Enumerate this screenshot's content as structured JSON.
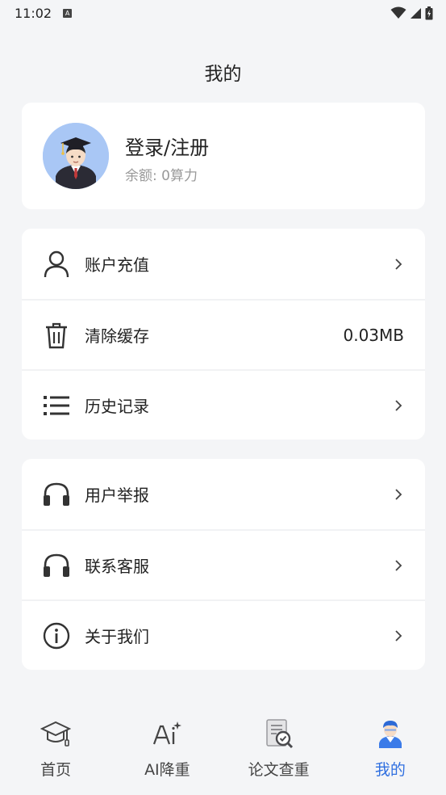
{
  "status_bar": {
    "time": "11:02",
    "notification_badge": "A"
  },
  "header": {
    "title": "我的"
  },
  "profile": {
    "login_label": "登录/注册",
    "balance": "余额: 0算力",
    "avatar_icon": "graduate-avatar-icon"
  },
  "menu_group_1": [
    {
      "label": "账户充值",
      "icon": "user-icon",
      "trailing": "chevron"
    },
    {
      "label": "清除缓存",
      "icon": "trash-icon",
      "value": "0.03MB"
    },
    {
      "label": "历史记录",
      "icon": "list-icon",
      "trailing": "chevron"
    }
  ],
  "menu_group_2": [
    {
      "label": "用户举报",
      "icon": "headphones-icon",
      "trailing": "chevron"
    },
    {
      "label": "联系客服",
      "icon": "headphones-icon",
      "trailing": "chevron"
    },
    {
      "label": "关于我们",
      "icon": "info-icon",
      "trailing": "chevron"
    }
  ],
  "tab_bar": [
    {
      "label": "首页",
      "icon": "graduation-cap-icon",
      "active": false
    },
    {
      "label": "AI降重",
      "icon": "ai-sparkle-icon",
      "active": false
    },
    {
      "label": "论文查重",
      "icon": "document-check-icon",
      "active": false
    },
    {
      "label": "我的",
      "icon": "user-avatar-icon",
      "active": true
    }
  ],
  "colors": {
    "accent": "#2f6fe0",
    "background": "#f4f5f7",
    "card": "#ffffff",
    "muted_text": "#999999"
  }
}
